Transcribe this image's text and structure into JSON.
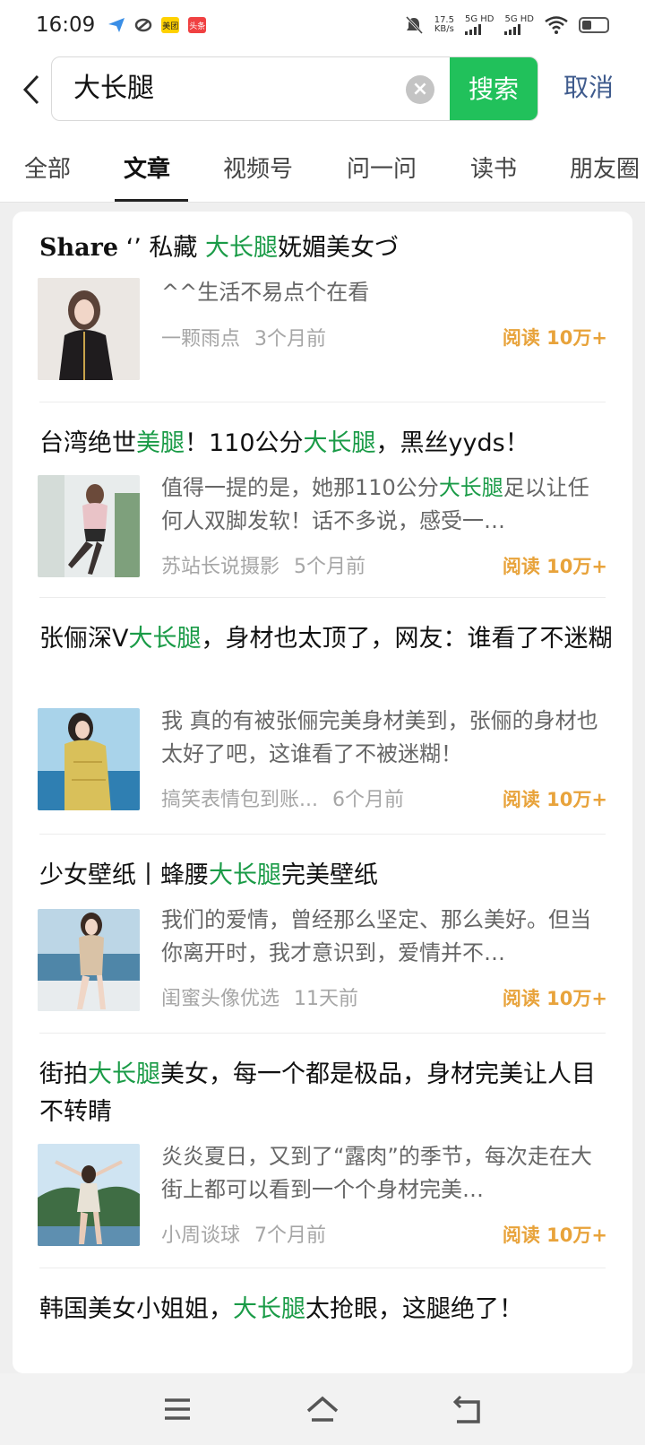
{
  "status": {
    "time": "16:09",
    "net_speed_value": "17.5",
    "net_speed_unit": "KB/s",
    "sig1": "5G HD",
    "sig2": "5G HD",
    "app_badge_1": "美团",
    "app_badge_2": "头条"
  },
  "search": {
    "query": "大长腿",
    "search_label": "搜索",
    "cancel_label": "取消"
  },
  "tabs": [
    {
      "label": "全部"
    },
    {
      "label": "文章"
    },
    {
      "label": "视频号"
    },
    {
      "label": "问一问"
    },
    {
      "label": "读书"
    },
    {
      "label": "朋友圈"
    }
  ],
  "results": [
    {
      "title_a": "Share",
      "title_b": " ‘’ 私藏 ",
      "title_hl": "大长腿",
      "title_c": "妩媚美女づ",
      "snippet": "^^生活不易点个在看",
      "author": "一颗雨点",
      "time": "3个月前",
      "reads": "阅读 10万+"
    },
    {
      "title_a": "台湾绝世",
      "title_hl1": "美腿",
      "title_b": "！110公分",
      "title_hl2": "大长腿",
      "title_c": "，黑丝yyds！",
      "snippet_a": "值得一提的是，她那110公分",
      "snippet_hl": "大长腿",
      "snippet_b": "足以让任何人双脚发软！话不多说，感受一…",
      "author": "苏站长说摄影",
      "time": "5个月前",
      "reads": "阅读 10万+"
    },
    {
      "title_a": "张俪深V",
      "title_hl": "大长腿",
      "title_b": "，身材也太顶了，网友：谁看了不迷糊",
      "snippet": "我 真的有被张俪完美身材美到，张俪的身材也太好了吧，这谁看了不被迷糊！",
      "author": "搞笑表情包到账...",
      "time": "6个月前",
      "reads": "阅读 10万+"
    },
    {
      "title_a": "少女壁纸丨蜂腰",
      "title_hl": "大长腿",
      "title_b": "完美壁纸",
      "snippet": "我们的爱情，曾经那么坚定、那么美好。但当你离开时，我才意识到，爱情并不…",
      "author": "闺蜜头像优选",
      "time": "11天前",
      "reads": "阅读 10万+"
    },
    {
      "title_a": "街拍",
      "title_hl": "大长腿",
      "title_b": "美女，每一个都是极品，身材完美让人目不转睛",
      "snippet": "炎炎夏日，又到了“露肉”的季节，每次走在大街上都可以看到一个个身材完美…",
      "author": "小周谈球",
      "time": "7个月前",
      "reads": "阅读 10万+"
    },
    {
      "title_a": "韩国美女小姐姐，",
      "title_hl": "大长腿",
      "title_b": "太抢眼，这腿绝了！"
    }
  ],
  "colors": {
    "accent_green": "#21c15b",
    "highlight_green": "#1a9b47",
    "reads_orange": "#e8a33b",
    "cancel_blue": "#3f5b8d"
  },
  "icons": [
    "back-arrow-icon",
    "clear-icon",
    "menu-icon",
    "home-icon",
    "back-nav-icon",
    "wifi-icon",
    "mute-icon",
    "battery-icon"
  ]
}
